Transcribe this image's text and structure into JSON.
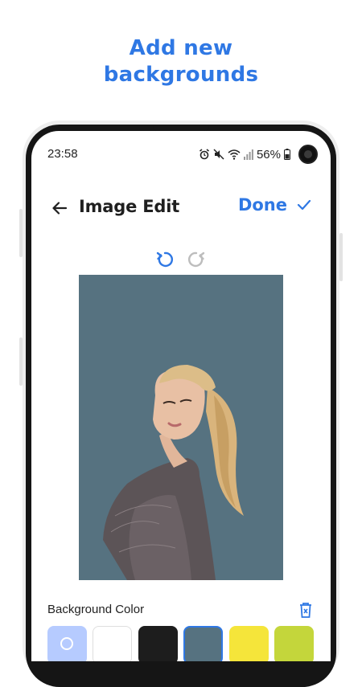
{
  "promo": {
    "line1": "Add new",
    "line2": "backgrounds"
  },
  "status_bar": {
    "time": "23:58",
    "battery_percent": "56%",
    "icons": [
      "alarm-icon",
      "mute-icon",
      "wifi-icon",
      "signal-icon",
      "battery-icon"
    ]
  },
  "app_bar": {
    "title": "Image Edit",
    "done_label": "Done",
    "back_icon": "arrow-left-icon",
    "done_icon": "check-icon"
  },
  "history": {
    "undo_icon": "undo-icon",
    "redo_icon": "redo-icon",
    "undo_enabled": true,
    "redo_enabled": false
  },
  "preview": {
    "background_color": "#567280"
  },
  "background_color": {
    "label": "Background Color",
    "clear_icon": "trash-icon",
    "swatches": [
      {
        "name": "picker",
        "color": "#b6cbff",
        "icon": "color-picker-icon",
        "selected": false
      },
      {
        "name": "white",
        "color": "#ffffff",
        "selected": false
      },
      {
        "name": "black",
        "color": "#1d1d1d",
        "selected": false
      },
      {
        "name": "slate",
        "color": "#567280",
        "selected": true
      },
      {
        "name": "yellow",
        "color": "#f5e53a",
        "selected": false
      },
      {
        "name": "lime",
        "color": "#c4d63b",
        "selected": false
      }
    ]
  },
  "colors": {
    "accent": "#2f78e4",
    "text": "#1f1f1f"
  }
}
